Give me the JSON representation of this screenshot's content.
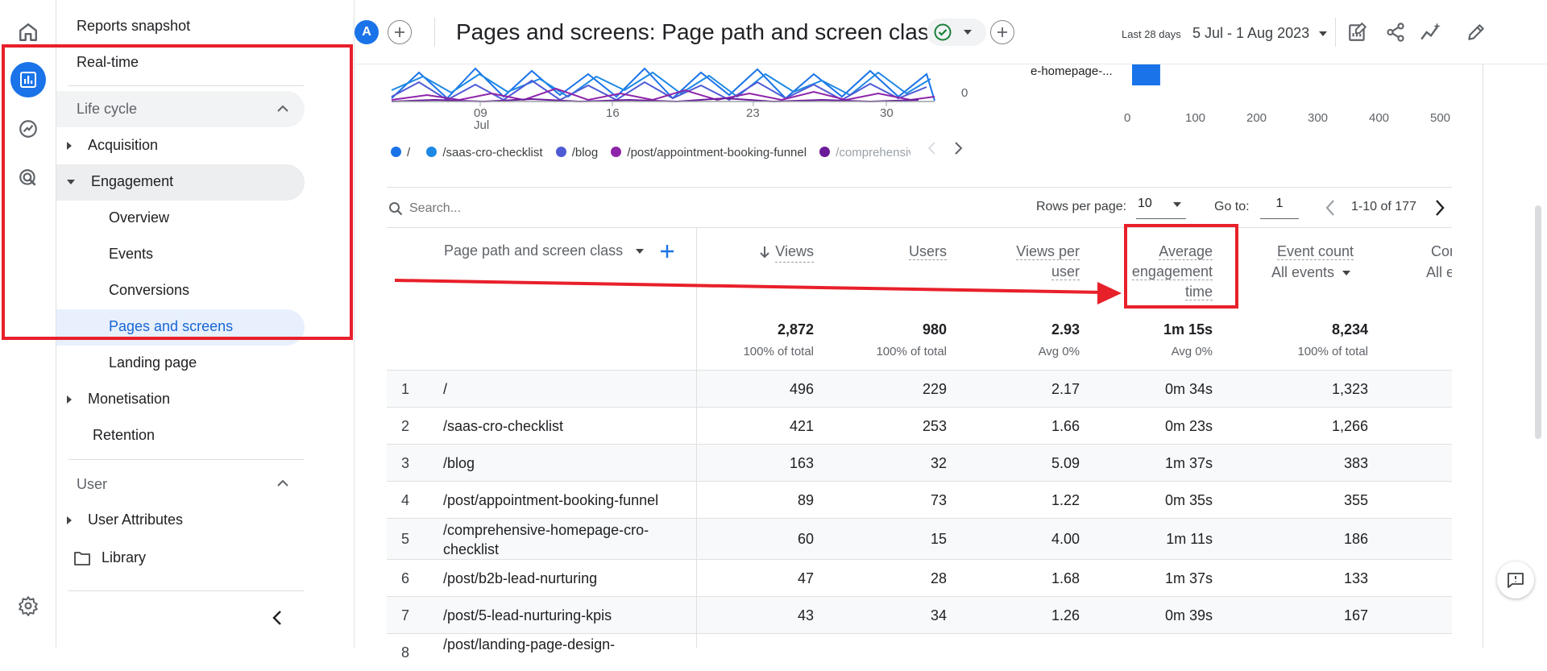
{
  "topbar": {
    "avatar_letter": "A",
    "title": "Pages and screens: Page path and screen class",
    "date_label": "Last 28 days",
    "date_range": "5 Jul - 1 Aug 2023"
  },
  "nav": {
    "reports_snapshot": "Reports snapshot",
    "realtime": "Real-time",
    "lifecycle": "Life cycle",
    "acquisition": "Acquisition",
    "engagement": "Engagement",
    "overview": "Overview",
    "events": "Events",
    "conversions": "Conversions",
    "pages_and_screens": "Pages and screens",
    "landing_page": "Landing page",
    "monetisation": "Monetisation",
    "retention": "Retention",
    "user": "User",
    "user_attributes": "User Attributes",
    "library": "Library"
  },
  "chart": {
    "x_ticks": [
      "09",
      "16",
      "23",
      "30"
    ],
    "x_month": "Jul",
    "y_zero": "0",
    "legend": [
      "/",
      "/saas-cro-checklist",
      "/blog",
      "/post/appointment-booking-funnel",
      "/comprehensiv"
    ],
    "legend_colors": [
      "#1a73e8",
      "#1e88e5",
      "#4f5bd5",
      "#8e24aa",
      "#6a1b9a"
    ],
    "bar_label": "e-homepage-...",
    "bar_ticks": [
      "0",
      "100",
      "200",
      "300",
      "400",
      "500"
    ],
    "bar_color": "#1a73e8"
  },
  "chart_data": {
    "type": "bar",
    "categories": [
      "e-homepage-..."
    ],
    "values": [
      60
    ],
    "xlim": [
      0,
      500
    ]
  },
  "table": {
    "search_placeholder": "Search...",
    "rows_per_page_label": "Rows per page:",
    "rows_per_page": "10",
    "goto_label": "Go to:",
    "goto_value": "1",
    "pagination": "1-10 of 177",
    "dimension": "Page path and screen class",
    "col_views": "Views",
    "col_users": "Users",
    "col_vpu_1": "Views per",
    "col_vpu_2": "user",
    "col_aet_1": "Average",
    "col_aet_2": "engagement",
    "col_aet_3": "time",
    "col_event": "Event count",
    "col_event_sub": "All events",
    "col_conv": "Cor",
    "col_conv_sub": "All e",
    "totals": {
      "views": "2,872",
      "views_sub": "100% of total",
      "users": "980",
      "users_sub": "100% of total",
      "vpu": "2.93",
      "vpu_sub": "Avg 0%",
      "aet": "1m 15s",
      "aet_sub": "Avg 0%",
      "events": "8,234",
      "events_sub": "100% of total"
    },
    "rows": [
      {
        "n": "1",
        "path": "/",
        "views": "496",
        "users": "229",
        "vpu": "2.17",
        "aet": "0m 34s",
        "events": "1,323"
      },
      {
        "n": "2",
        "path": "/saas-cro-checklist",
        "views": "421",
        "users": "253",
        "vpu": "1.66",
        "aet": "0m 23s",
        "events": "1,266"
      },
      {
        "n": "3",
        "path": "/blog",
        "views": "163",
        "users": "32",
        "vpu": "5.09",
        "aet": "1m 37s",
        "events": "383"
      },
      {
        "n": "4",
        "path": "/post/appointment-booking-funnel",
        "views": "89",
        "users": "73",
        "vpu": "1.22",
        "aet": "0m 35s",
        "events": "355"
      },
      {
        "n": "5",
        "path": "/comprehensive-homepage-cro-checklist",
        "path_1": "/comprehensive-homepage-cro-",
        "path_2": "checklist",
        "views": "60",
        "users": "15",
        "vpu": "4.00",
        "aet": "1m 11s",
        "events": "186"
      },
      {
        "n": "6",
        "path": "/post/b2b-lead-nurturing",
        "views": "47",
        "users": "28",
        "vpu": "1.68",
        "aet": "1m 37s",
        "events": "133"
      },
      {
        "n": "7",
        "path": "/post/5-lead-nurturing-kpis",
        "views": "43",
        "users": "34",
        "vpu": "1.26",
        "aet": "0m 39s",
        "events": "167"
      },
      {
        "n": "8",
        "path": "/post/landing-page-design-"
      }
    ]
  }
}
